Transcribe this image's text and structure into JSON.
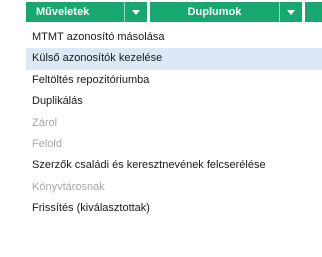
{
  "toolbar": {
    "actions_label": "Műveletek",
    "duplicates_label": "Duplumok",
    "accent_color": "#18a86f"
  },
  "menu": {
    "items": [
      {
        "label": "MTMT azonosító másolása",
        "state": "normal"
      },
      {
        "label": "Külső azonosítók kezelése",
        "state": "hover"
      },
      {
        "label": "Feltöltés repozitóriumba",
        "state": "normal"
      },
      {
        "label": "Duplikálás",
        "state": "normal"
      },
      {
        "label": "Zárol",
        "state": "disabled"
      },
      {
        "label": "Felold",
        "state": "disabled"
      },
      {
        "label": "Szerzők családi és keresztnevének felcserélése",
        "state": "normal"
      },
      {
        "label": "Könyvtárosnak",
        "state": "disabled"
      },
      {
        "label": "Frissítés (kiválasztottak)",
        "state": "normal"
      }
    ]
  }
}
